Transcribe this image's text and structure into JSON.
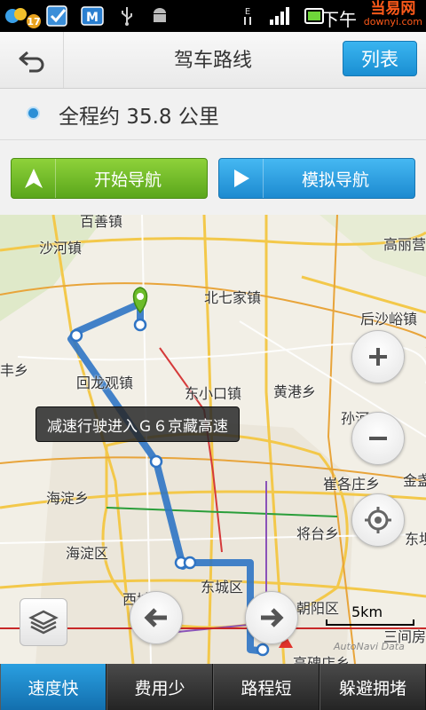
{
  "status_bar": {
    "notification_count": "17",
    "time_partial": "下午",
    "icons": [
      "app-badge-icon",
      "checkbox-icon",
      "mail-icon",
      "usb-icon",
      "android-icon",
      "data-transfer-icon",
      "signal-icon",
      "battery-icon"
    ]
  },
  "watermark": {
    "line1": "当易网",
    "line2": "downyi.com"
  },
  "header": {
    "title": "驾车路线",
    "list_button": "列表",
    "back_icon": "back-arrow-icon"
  },
  "summary": {
    "distance_text": "全程约 35.8 公里"
  },
  "actions": {
    "start_nav": "开始导航",
    "simulate_nav": "模拟导航"
  },
  "map": {
    "places": {
      "baishan": "百善镇",
      "shahe": "沙河镇",
      "gaoliying": "高丽营",
      "beiqijia": "北七家镇",
      "houshayu": "后沙峪镇",
      "fengxiang": "丰乡",
      "huilongguan": "回龙观镇",
      "dongxiaokou": "东小口镇",
      "huanggang": "黄港乡",
      "sunhe": "孙河",
      "haidianxiang": "海淀乡",
      "cuigezhuang": "崔各庄乡",
      "jinzhan": "金盏",
      "haidianqu": "海淀区",
      "jiangtai": "将台乡",
      "dongba": "东坝乡",
      "xichengqu": "西城区",
      "dongchengqu": "东城区",
      "chaoyangqu": "朝阳区",
      "sanjianfang": "三间房",
      "gaobeidian": "高碑店乡"
    },
    "tooltip": "减速行驶进入Ｇ６京藏高速",
    "scale_label": "5km",
    "copyright": "AutoNavi Data"
  },
  "tabs": [
    {
      "label": "速度快",
      "active": true
    },
    {
      "label": "费用少",
      "active": false
    },
    {
      "label": "路程短",
      "active": false
    },
    {
      "label": "躲避拥堵",
      "active": false
    }
  ],
  "colors": {
    "accent_blue": "#1a8ed2",
    "start_green": "#5aa61b",
    "route_blue": "#2f74c4"
  }
}
